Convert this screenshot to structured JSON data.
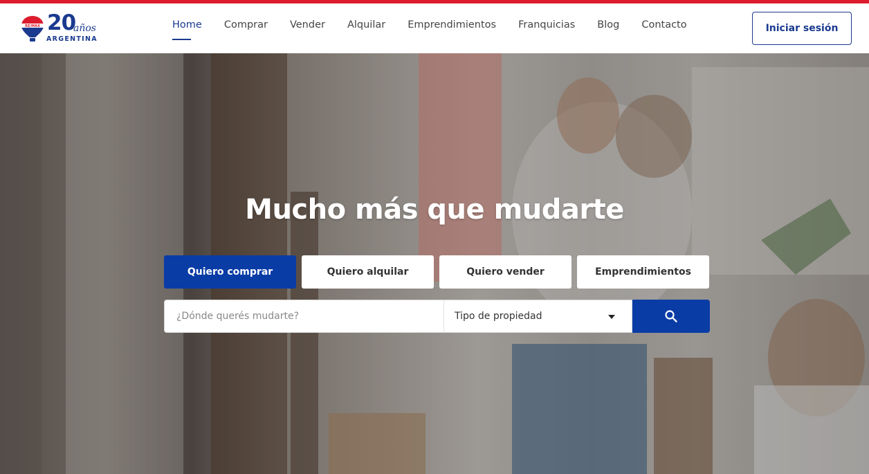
{
  "brand": {
    "logo_number": "20",
    "logo_suffix": "años",
    "logo_country": "ARGENTINA",
    "balloon_text": "RE/MAX",
    "colors": {
      "primary": "#1a3a8f",
      "button": "#0a3ca6",
      "accent": "#dc1c2e"
    }
  },
  "nav": {
    "items": [
      {
        "label": "Home",
        "active": true
      },
      {
        "label": "Comprar"
      },
      {
        "label": "Vender"
      },
      {
        "label": "Alquilar"
      },
      {
        "label": "Emprendimientos"
      },
      {
        "label": "Franquicias"
      },
      {
        "label": "Blog"
      },
      {
        "label": "Contacto"
      }
    ]
  },
  "header": {
    "login_label": "Iniciar sesión"
  },
  "hero": {
    "title": "Mucho más que mudarte",
    "tabs": [
      {
        "label": "Quiero comprar",
        "active": true
      },
      {
        "label": "Quiero alquilar"
      },
      {
        "label": "Quiero vender"
      },
      {
        "label": "Emprendimientos"
      }
    ],
    "search": {
      "placeholder": "¿Dónde querés mudarte?",
      "property_type": "Tipo de propiedad",
      "icon": "search-icon"
    }
  }
}
